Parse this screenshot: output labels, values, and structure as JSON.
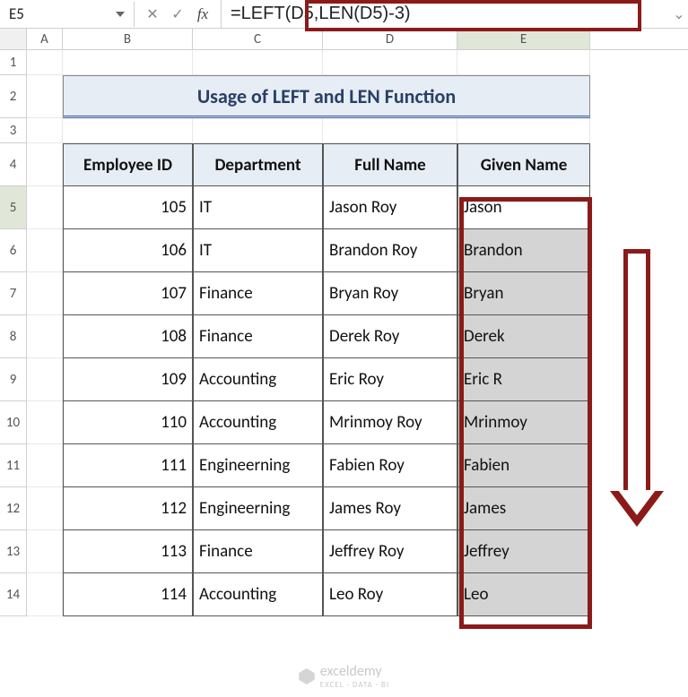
{
  "nameBox": "E5",
  "formula": "=LEFT(D5,LEN(D5)-3)",
  "columns": [
    "A",
    "B",
    "C",
    "D",
    "E"
  ],
  "title": "Usage of LEFT and LEN Function",
  "headers": {
    "B": "Employee ID",
    "C": "Department",
    "D": "Full Name",
    "E": "Given Name"
  },
  "rows": [
    {
      "num": 5,
      "id": "105",
      "dept": "IT",
      "full": "Jason Roy",
      "given": "Jason"
    },
    {
      "num": 6,
      "id": "106",
      "dept": "IT",
      "full": "Brandon Roy",
      "given": "Brandon"
    },
    {
      "num": 7,
      "id": "107",
      "dept": "Finance",
      "full": "Bryan Roy",
      "given": "Bryan"
    },
    {
      "num": 8,
      "id": "108",
      "dept": "Finance",
      "full": "Derek Roy",
      "given": "Derek"
    },
    {
      "num": 9,
      "id": "109",
      "dept": "Accounting",
      "full": "Eric Roy",
      "given": "Eric R"
    },
    {
      "num": 10,
      "id": "110",
      "dept": "Accounting",
      "full": "Mrinmoy Roy",
      "given": "Mrinmoy"
    },
    {
      "num": 11,
      "id": "111",
      "dept": "Engineerning",
      "full": "Fabien Roy",
      "given": "Fabien"
    },
    {
      "num": 12,
      "id": "112",
      "dept": "Engineerning",
      "full": "James Roy",
      "given": "James"
    },
    {
      "num": 13,
      "id": "113",
      "dept": "Finance",
      "full": "Jeffrey Roy",
      "given": "Jeffrey"
    },
    {
      "num": 14,
      "id": "114",
      "dept": "Accounting",
      "full": "Leo Roy",
      "given": "Leo"
    }
  ],
  "watermark": {
    "main": "exceldemy",
    "sub": "EXCEL · DATA · BI"
  },
  "rowNums": {
    "r1": "1",
    "r2": "2",
    "r3": "3",
    "r4": "4"
  }
}
